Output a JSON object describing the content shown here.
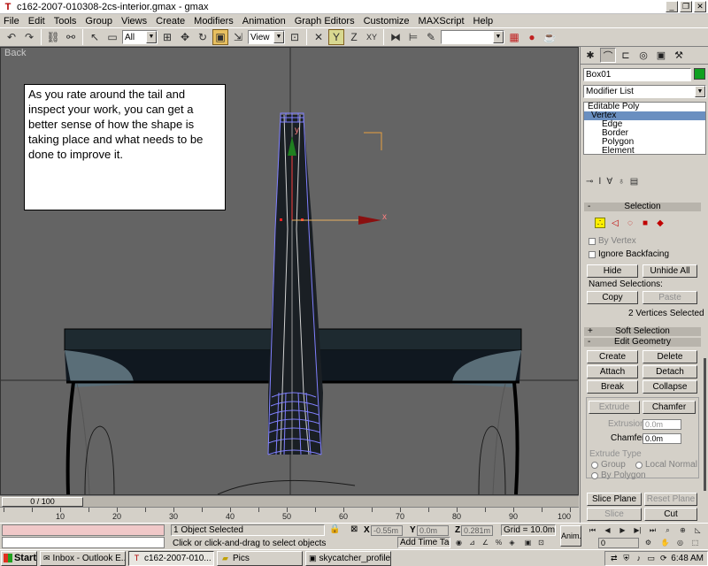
{
  "window": {
    "title": "c162-2007-010308-2cs-interior.gmax - gmax",
    "minimize": "_",
    "restore": "❐",
    "close": "✕"
  },
  "menu": [
    "File",
    "Edit",
    "Tools",
    "Group",
    "Views",
    "Create",
    "Modifiers",
    "Animation",
    "Graph Editors",
    "Customize",
    "MAXScript",
    "Help"
  ],
  "toolbar": {
    "selection_filter": "All",
    "reference_coord": "View",
    "named_selection": ""
  },
  "viewport": {
    "label": "Back",
    "tip_text": "As you rate around the tail and inspect your work, you can get a better sense of how the shape is taking place and what needs to be done to improve it.",
    "gizmo_y": "y",
    "gizmo_x": "x"
  },
  "command_panel": {
    "object_name": "Box01",
    "object_color": "#10a020",
    "modifier_list": "Modifier List",
    "stack": [
      "Editable Poly",
      "Vertex",
      "Edge",
      "Border",
      "Polygon",
      "Element"
    ],
    "selected_subobject": "Vertex",
    "selection": {
      "title": "Selection",
      "by_vertex": "By Vertex",
      "ignore_backfacing": "Ignore Backfacing",
      "hide": "Hide",
      "unhide_all": "Unhide All",
      "named_selections": "Named Selections:",
      "copy": "Copy",
      "paste": "Paste",
      "status": "2 Vertices Selected"
    },
    "soft_selection": "Soft Selection",
    "edit_geometry": {
      "title": "Edit Geometry",
      "create": "Create",
      "delete": "Delete",
      "attach": "Attach",
      "detach": "Detach",
      "break": "Break",
      "collapse": "Collapse",
      "extrude": "Extrude",
      "chamfer": "Chamfer",
      "extrusion_label": "Extrusion",
      "extrusion_value": "0.0m",
      "chamfer_label": "Chamfer",
      "chamfer_value": "0.0m",
      "extrude_type": "Extrude Type",
      "group": "Group",
      "local_normal": "Local Normal",
      "by_polygon": "By Polygon",
      "slice_plane": "Slice Plane",
      "reset_plane": "Reset Plane",
      "slice": "Slice",
      "cut": "Cut"
    }
  },
  "timeline": {
    "slider": "0 / 100",
    "ticks": [
      10,
      20,
      30,
      40,
      50,
      60,
      70,
      80,
      90,
      100
    ]
  },
  "status": {
    "objects_selected": "1 Object Selected",
    "prompt": "Click or click-and-drag to select objects",
    "x_label": "X",
    "x_value": "-0.55m",
    "y_label": "Y",
    "y_value": "0.0m",
    "z_label": "Z",
    "z_value": "0.281m",
    "grid": "Grid = 10.0m",
    "add_time_tag": "Add Time Tag",
    "anim": "Anim.",
    "frame": "0"
  },
  "taskbar": {
    "start": "Start",
    "tasks": [
      "Inbox - Outlook E...",
      "c162-2007-010...",
      "Pics",
      "skycatcher_profile...."
    ],
    "clock": "6:48 AM"
  }
}
